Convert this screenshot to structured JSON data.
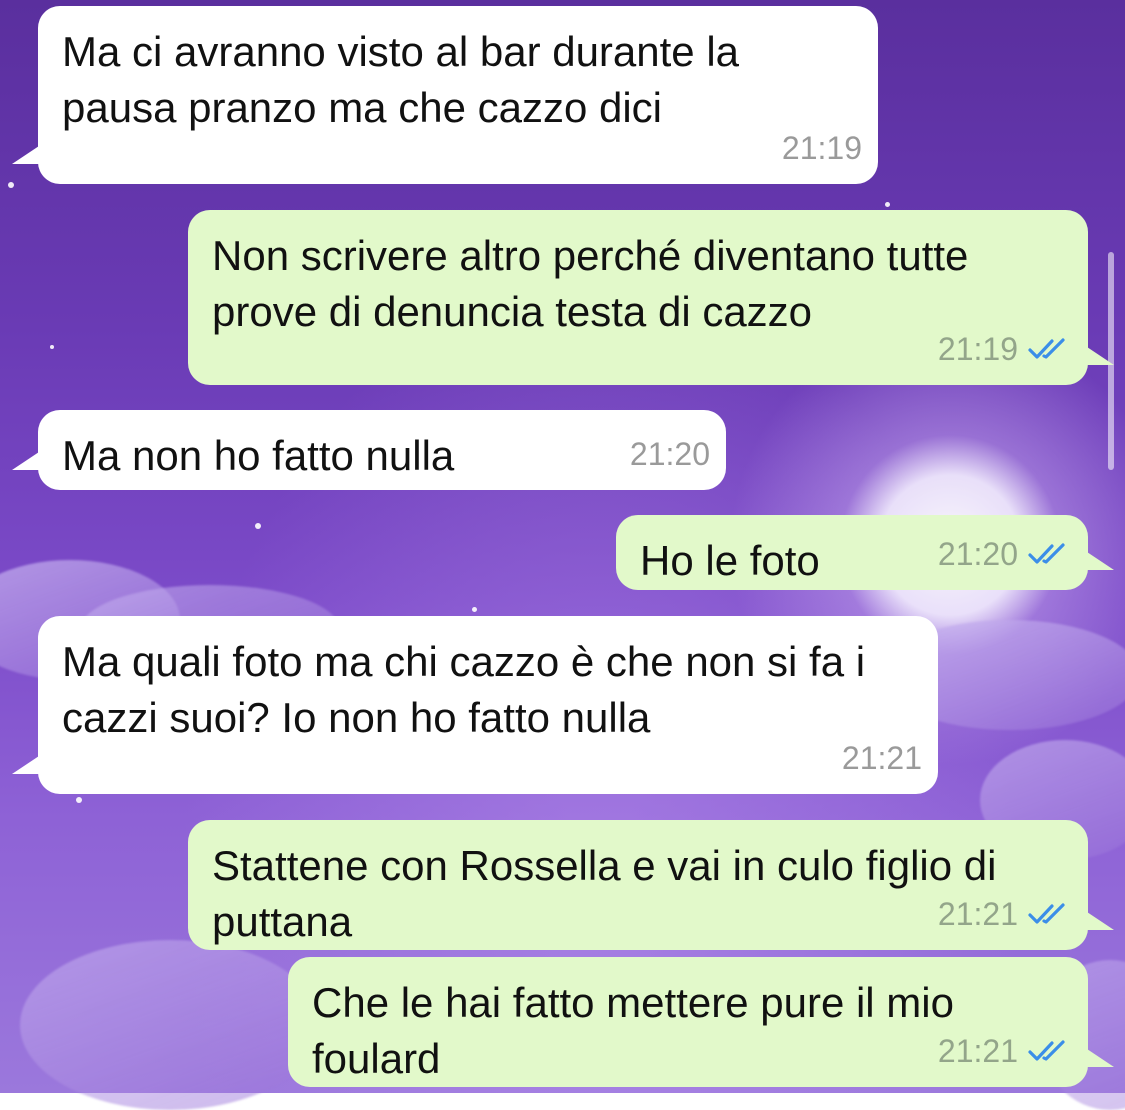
{
  "colors": {
    "incoming_bubble": "#ffffff",
    "outgoing_bubble": "#e2f9ca",
    "read_check": "#3b8ee8",
    "timestamp": "#9a9a9a"
  },
  "messages": [
    {
      "direction": "incoming",
      "text": "Ma ci avranno visto al bar durante la pausa pranzo ma che cazzo dici",
      "time": "21:19"
    },
    {
      "direction": "outgoing",
      "text": "Non scrivere altro perché diventano tutte prove di denuncia testa di cazzo",
      "time": "21:19",
      "status_icon": "double-check-read-icon"
    },
    {
      "direction": "incoming",
      "text": "Ma non ho fatto nulla",
      "time": "21:20"
    },
    {
      "direction": "outgoing",
      "text": "Ho le foto",
      "time": "21:20",
      "status_icon": "double-check-read-icon"
    },
    {
      "direction": "incoming",
      "text": "Ma quali foto ma chi cazzo è che non si fa i cazzi suoi? Io non ho fatto nulla",
      "time": "21:21"
    },
    {
      "direction": "outgoing",
      "text": "Stattene con Rossella e vai in culo figlio di puttana",
      "time": "21:21",
      "status_icon": "double-check-read-icon"
    },
    {
      "direction": "outgoing",
      "text": "Che le hai fatto mettere pure il mio foulard",
      "time": "21:21",
      "status_icon": "double-check-read-icon"
    }
  ]
}
